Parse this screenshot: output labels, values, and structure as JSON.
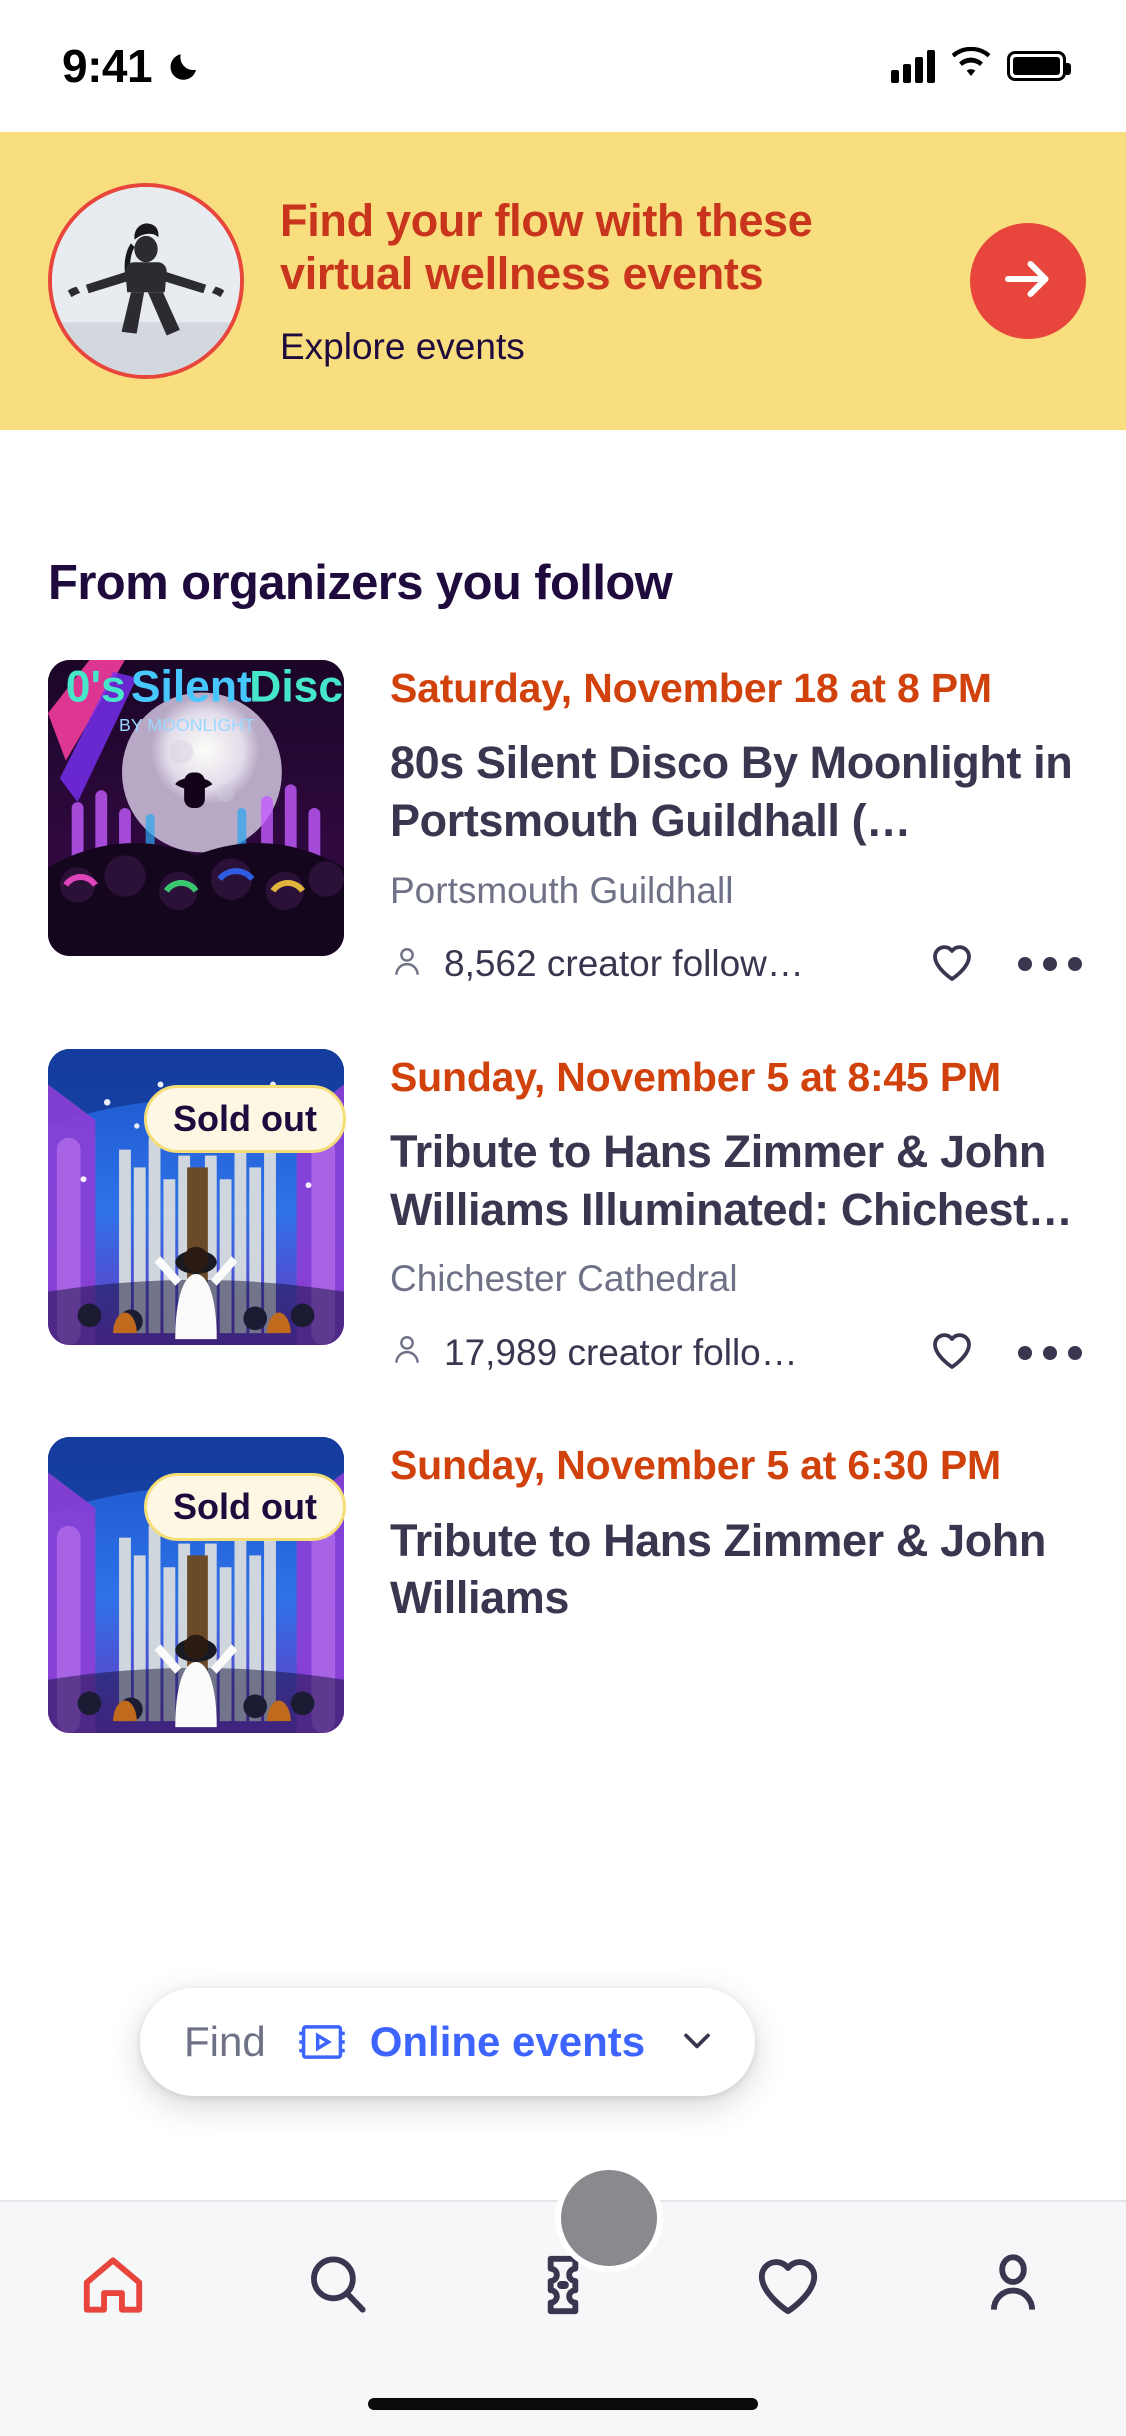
{
  "status_bar": {
    "time": "9:41",
    "dnd_icon": "moon-icon",
    "signal_icon": "cellular-signal-icon",
    "wifi_icon": "wifi-icon",
    "battery_icon": "battery-full-icon"
  },
  "promo_banner": {
    "background_color": "#F8DE7E",
    "title": "Find your flow with these virtual wellness events",
    "title_color": "#C9341C",
    "subtitle": "Explore events",
    "subtitle_color": "#1E0A3C",
    "avatar_icon": "yoga-photo",
    "arrow_icon": "arrow-right-icon",
    "arrow_color": "#E8463C"
  },
  "section": {
    "heading": "From organizers you follow",
    "heading_color": "#1E0A3C"
  },
  "events": [
    {
      "thumbnail_alt": "80s-silent-disco-moonlight-poster",
      "badge": "",
      "date": "Saturday, November 18 at 8 PM",
      "date_color": "#D1410C",
      "title": "80s Silent Disco By Moonlight in Portsmouth Guildhall (…",
      "venue": "Portsmouth Guildhall",
      "followers": "8,562 creator follow…",
      "follower_icon": "person-icon",
      "like_icon": "heart-outline-icon",
      "more_icon": "more-options-icon"
    },
    {
      "thumbnail_alt": "cathedral-organ-orchestra-photo",
      "badge": "Sold out",
      "date": "Sunday, November 5 at 8:45 PM",
      "date_color": "#D1410C",
      "title": "Tribute to Hans Zimmer & John Williams Illuminated: Chichest…",
      "venue": "Chichester Cathedral",
      "followers": "17,989 creator follo…",
      "follower_icon": "person-icon",
      "like_icon": "heart-outline-icon",
      "more_icon": "more-options-icon"
    },
    {
      "thumbnail_alt": "cathedral-organ-orchestra-photo",
      "badge": "Sold out",
      "date": "Sunday, November 5 at 6:30 PM",
      "date_color": "#D1410C",
      "title": "Tribute to Hans Zimmer & John Williams",
      "venue": "",
      "followers": "",
      "follower_icon": "person-icon",
      "like_icon": "heart-outline-icon",
      "more_icon": "more-options-icon"
    }
  ],
  "floating_filter": {
    "prefix": "Find",
    "prefix_color": "#6F7287",
    "icon": "online-video-icon",
    "value": "Online events",
    "value_color": "#3D64FF",
    "chevron_icon": "chevron-down-icon"
  },
  "bottom_nav": {
    "items": [
      {
        "name": "home",
        "icon": "home-icon",
        "active": true,
        "color": "#E8463C"
      },
      {
        "name": "search",
        "icon": "search-icon",
        "active": false,
        "color": "#39364F"
      },
      {
        "name": "tickets",
        "icon": "ticket-icon",
        "active": false,
        "color": "#39364F"
      },
      {
        "name": "saved",
        "icon": "heart-icon",
        "active": false,
        "color": "#39364F"
      },
      {
        "name": "profile",
        "icon": "person-icon",
        "active": false,
        "color": "#39364F"
      }
    ]
  },
  "cursor": {
    "icon": "touch-cursor",
    "color": "#8A8A8E"
  }
}
